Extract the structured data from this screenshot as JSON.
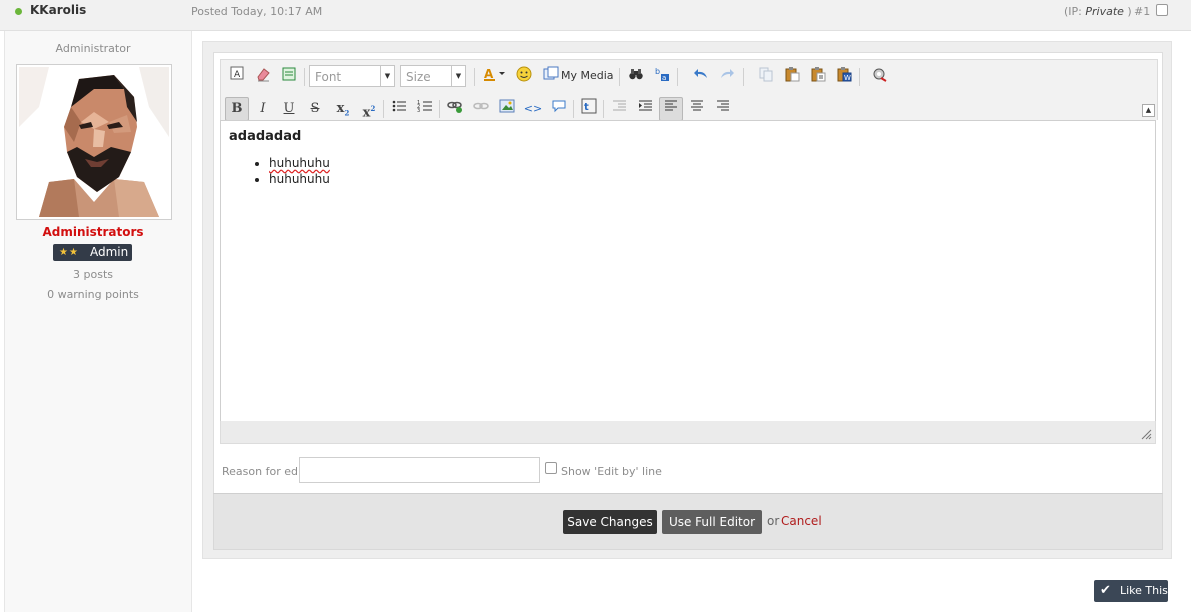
{
  "post": {
    "username": "KKarolis",
    "posted": "Posted Today, 10:17 AM",
    "ip_prefix": "(IP: ",
    "ip_value": "Private",
    "ip_suffix": " )",
    "post_number": "#1"
  },
  "author": {
    "title": "Administrator",
    "group": "Administrators",
    "rank_stars": "★★",
    "rank_label": "Admin",
    "posts": "3 posts",
    "warnings": "0 warning points"
  },
  "editor": {
    "font_placeholder": "Font",
    "size_placeholder": "Size",
    "my_media": "My Media",
    "content_heading": "adadadad",
    "list_items": [
      "huhuhuhu",
      "huhuhuhu"
    ],
    "reason_label": "Reason for edit:",
    "show_edit_label": "Show 'Edit by' line"
  },
  "actions": {
    "save": "Save Changes",
    "full_editor": "Use Full Editor",
    "or": "or",
    "cancel": "Cancel"
  },
  "like": {
    "label": "Like This"
  },
  "colors": {
    "group": "#d20f0f",
    "rank_badge": "#333b48",
    "cancel": "#b01c1c",
    "online": "#6bb63a"
  }
}
